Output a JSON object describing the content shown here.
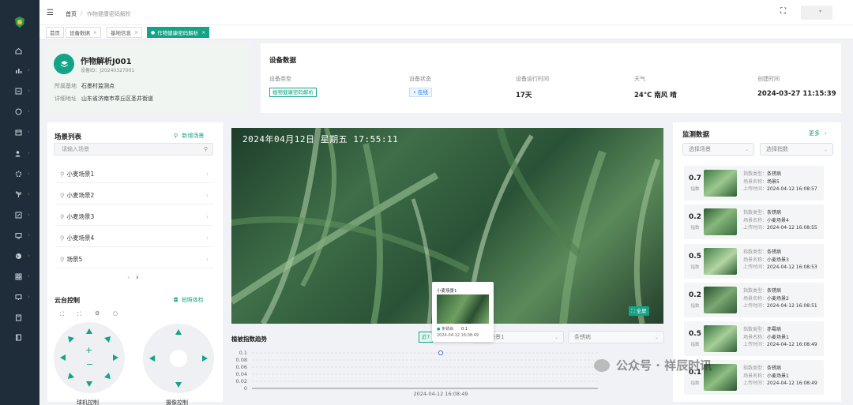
{
  "topbar": {
    "breadcrumb_home": "首页",
    "breadcrumb_sep": "/",
    "breadcrumb_current": "作物健康密码解析"
  },
  "tabs": [
    {
      "label": "首页",
      "active": false
    },
    {
      "label": "设备数据",
      "active": false
    },
    {
      "label": "基地信息",
      "active": false
    },
    {
      "label": "作物健康密码解析",
      "active": true
    }
  ],
  "device_card": {
    "name": "作物解析J001",
    "id_label": "设备ID：",
    "id": "J20240327001",
    "base_label": "所属基地",
    "base": "石墨村监测点",
    "addr_label": "详细地址",
    "addr": "山东省济南市章丘区圣井街道"
  },
  "device_data": {
    "title": "设备数据",
    "cols": [
      {
        "label": "设备类型",
        "value": "植物健康密码解析"
      },
      {
        "label": "设备状态",
        "value": "在线"
      },
      {
        "label": "设备运行时间",
        "value": "17天"
      },
      {
        "label": "天气",
        "value": "24°C 南风 晴"
      },
      {
        "label": "创建时间",
        "value": "2024-03-27 11:15:39"
      }
    ]
  },
  "scene_list": {
    "title": "场景列表",
    "add_label": "新增场景",
    "search_placeholder": "请输入场景",
    "items": [
      "小麦场景1",
      "小麦场景2",
      "小麦场景3",
      "小麦场景4",
      "场景5"
    ]
  },
  "ptz": {
    "title": "云台控制",
    "capture_label": "拍照体检",
    "left_label": "球机控制",
    "right_label": "摄像控制",
    "plus": "+",
    "minus": "−"
  },
  "video": {
    "timestamp": "2024年04月12日  星期五  17:55:11",
    "fullscreen_label": "全屏"
  },
  "trend": {
    "title": "植被指数趋势",
    "btn": "近7",
    "scene_select": "小麦场景1",
    "disease_select": "条锈病",
    "y_ticks": [
      "0.1",
      "0.08",
      "0.06",
      "0.04",
      "0.02",
      "0"
    ],
    "x_label": "2024-04-12 16:08:49",
    "tooltip": {
      "scene": "小麦场景1",
      "disease": "条锈病",
      "value": "0.1",
      "time": "2024-04-12 16:08:49"
    }
  },
  "chart_data": {
    "type": "line",
    "x": [
      "2024-04-12 16:08:49"
    ],
    "series": [
      {
        "values": [
          0.1
        ]
      }
    ],
    "ylim": [
      0,
      0.1
    ],
    "grid": true
  },
  "monitor": {
    "title": "监测数据",
    "more": "更多",
    "select_scene": "选择场景",
    "select_index": "选择指数",
    "type_label": "指数类型：",
    "scene_label": "场景名称：",
    "time_label": "上传时间：",
    "index_label": "指数",
    "records": [
      {
        "value": "0.7",
        "type": "条锈病",
        "scene": "场景5",
        "time": "2024-04-12 16:08:57"
      },
      {
        "value": "0.2",
        "type": "条锈病",
        "scene": "小麦场景4",
        "time": "2024-04-12 16:08:55"
      },
      {
        "value": "0.5",
        "type": "条锈病",
        "scene": "小麦场景3",
        "time": "2024-04-12 16:08:53"
      },
      {
        "value": "0.2",
        "type": "条锈病",
        "scene": "小麦场景2",
        "time": "2024-04-12 16:08:51"
      },
      {
        "value": "0.5",
        "type": "赤霉病",
        "scene": "小麦场景1",
        "time": "2024-04-12 16:08:49"
      },
      {
        "value": "0.1",
        "type": "条锈病",
        "scene": "小麦场景1",
        "time": "2024-04-12 16:08:49"
      }
    ]
  },
  "watermark": "公众号 · 祥辰时讯",
  "colors": {
    "accent": "#13a386",
    "sidebar": "#1f2d3a",
    "status_online": "#1677ff"
  }
}
